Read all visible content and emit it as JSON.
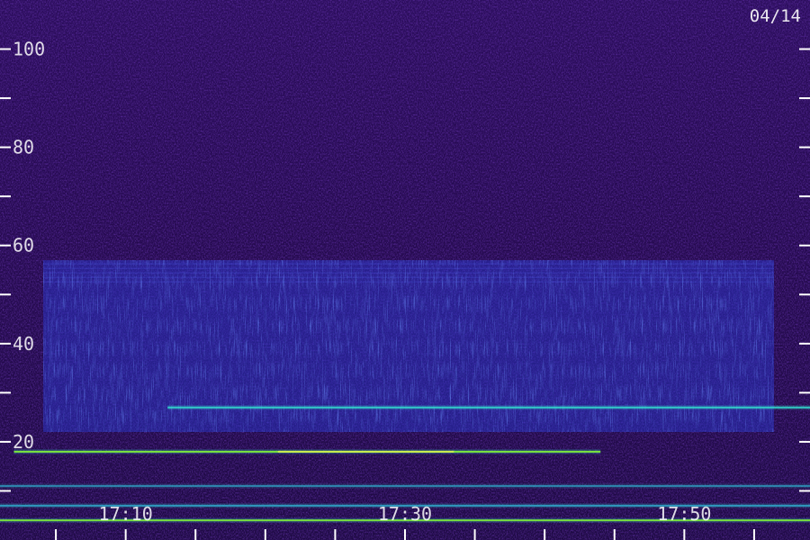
{
  "chart_data": {
    "type": "heatmap",
    "title": "",
    "xlabel": "",
    "ylabel": "",
    "date_label": "04/14",
    "x_range": [
      "17:01",
      "17:59"
    ],
    "y_range": [
      0,
      110
    ],
    "x_ticks": [
      "17:10",
      "17:30",
      "17:50"
    ],
    "y_ticks": [
      "20",
      "40",
      "60",
      "80",
      "100"
    ],
    "grid": false,
    "colors": {
      "background_low": "#2a0a55",
      "background_mid": "#3a1599",
      "band_blue": "#2a3ad8",
      "line_cyan": "#33e0d0",
      "line_green": "#7de63c",
      "line_yellow": "#d6f050",
      "axis": "#ffffff"
    },
    "features": [
      {
        "kind": "band",
        "y_from": 22,
        "y_to": 57,
        "intensity": 0.45
      },
      {
        "kind": "line",
        "y": 27,
        "x_start": "17:13",
        "x_end": "17:59",
        "intensity": 0.85
      },
      {
        "kind": "line",
        "y": 18,
        "x_start": "17:02",
        "x_end": "17:44",
        "intensity": 1.0
      },
      {
        "kind": "line",
        "y": 4,
        "x_start": "17:00",
        "x_end": "17:59",
        "intensity": 0.95
      },
      {
        "kind": "line",
        "y": 7,
        "x_start": "17:00",
        "x_end": "17:59",
        "intensity": 0.75
      },
      {
        "kind": "line",
        "y": 11,
        "x_start": "17:00",
        "x_end": "17:59",
        "intensity": 0.6
      }
    ]
  }
}
